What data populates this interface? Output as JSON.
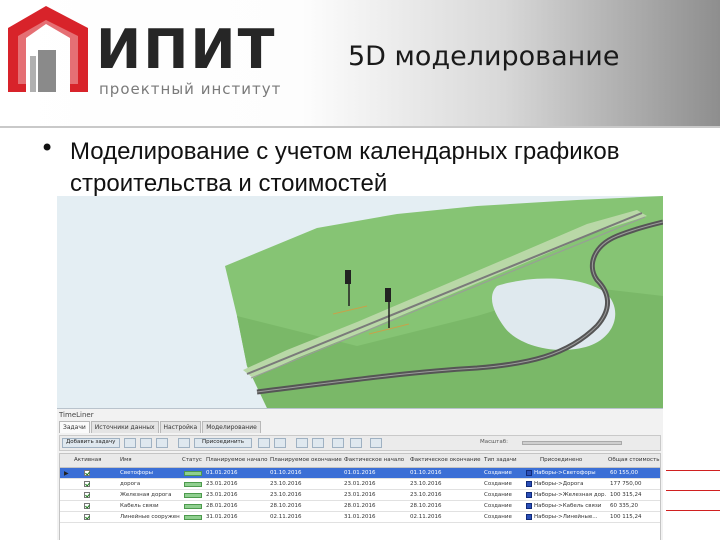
{
  "logo": {
    "name": "ИПИТ",
    "subtitle": "проектный институт",
    "colors": {
      "red": "#d8232a",
      "gray": "#777777"
    }
  },
  "slide": {
    "title": "5D моделирование",
    "bullet": "Моделирование с учетом календарных графиков строительства и стоимостей"
  },
  "timeliner": {
    "title": "TimeLiner",
    "tabs": [
      "Задачи",
      "Источники данных",
      "Настройка",
      "Моделирование"
    ],
    "toolbar": {
      "add_task": "Добавить задачу",
      "attach": "Присоединить",
      "zoom_label": "Масштаб:"
    },
    "columns": [
      "Активная",
      "Имя",
      "Статус",
      "Планируемое начало",
      "Планируемое окончание",
      "Фактическое начало",
      "Фактическое окончание",
      "Тип задачи",
      "Присоединено",
      "Общая стоимость"
    ],
    "rows": [
      {
        "name": "Светофоры",
        "start": "01.01.2016",
        "end": "01.10.2016",
        "actual_start": "01.01.2016",
        "actual_end": "01.10.2016",
        "type": "Создание",
        "attached": "Наборы->Светофоры",
        "cost": "60 155,00",
        "selected": true
      },
      {
        "name": "дорога",
        "start": "23.01.2016",
        "end": "23.10.2016",
        "actual_start": "23.01.2016",
        "actual_end": "23.10.2016",
        "type": "Создание",
        "attached": "Наборы->Дорога",
        "cost": "177 750,00",
        "selected": false
      },
      {
        "name": "Железная дорога",
        "start": "23.01.2016",
        "end": "23.10.2016",
        "actual_start": "23.01.2016",
        "actual_end": "23.10.2016",
        "type": "Создание",
        "attached": "Наборы->Железная дор...",
        "cost": "100 315,24",
        "selected": false
      },
      {
        "name": "Кабель связи",
        "start": "28.01.2016",
        "end": "28.10.2016",
        "actual_start": "28.01.2016",
        "actual_end": "28.10.2016",
        "type": "Создание",
        "attached": "Наборы->Кабель связи",
        "cost": "60 335,20",
        "selected": false
      },
      {
        "name": "Линейные сооружения",
        "start": "31.01.2016",
        "end": "02.11.2016",
        "actual_start": "31.01.2016",
        "actual_end": "02.11.2016",
        "type": "Создание",
        "attached": "Наборы->Линейные...",
        "cost": "100 115,24",
        "selected": false
      }
    ]
  }
}
